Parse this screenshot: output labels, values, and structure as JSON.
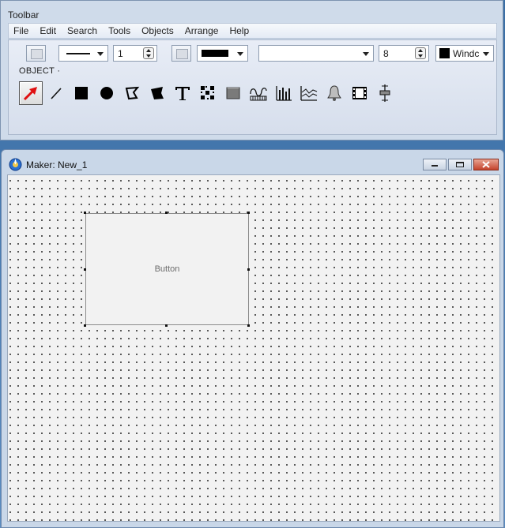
{
  "toolbar_window": {
    "title": "Toolbar",
    "menu": [
      "File",
      "Edit",
      "Search",
      "Tools",
      "Objects",
      "Arrange",
      "Help"
    ],
    "line_width_value": "1",
    "font_size_value": "8",
    "font_name_value": "",
    "color_combo_label": "Windc",
    "section_label": "OBJECT ·",
    "tools": [
      {
        "icon": "select-arrow-icon",
        "selected": true
      },
      {
        "icon": "line-icon"
      },
      {
        "icon": "rectangle-icon"
      },
      {
        "icon": "ellipse-icon"
      },
      {
        "icon": "polygon-icon"
      },
      {
        "icon": "filled-polygon-icon"
      },
      {
        "icon": "text-icon"
      },
      {
        "icon": "pattern-icon"
      },
      {
        "icon": "button-object-icon"
      },
      {
        "icon": "trend-icon"
      },
      {
        "icon": "bar-graph-icon"
      },
      {
        "icon": "line-graph-icon"
      },
      {
        "icon": "alarm-bell-icon"
      },
      {
        "icon": "film-icon"
      },
      {
        "icon": "slider-icon"
      }
    ]
  },
  "maker_window": {
    "title": "Maker: New_1",
    "canvas_object": {
      "label": "Button"
    }
  },
  "colors": {
    "selected_arrow": "#e01010",
    "canvas_background": "#f2f2f2",
    "close_button": "#c4432c"
  }
}
